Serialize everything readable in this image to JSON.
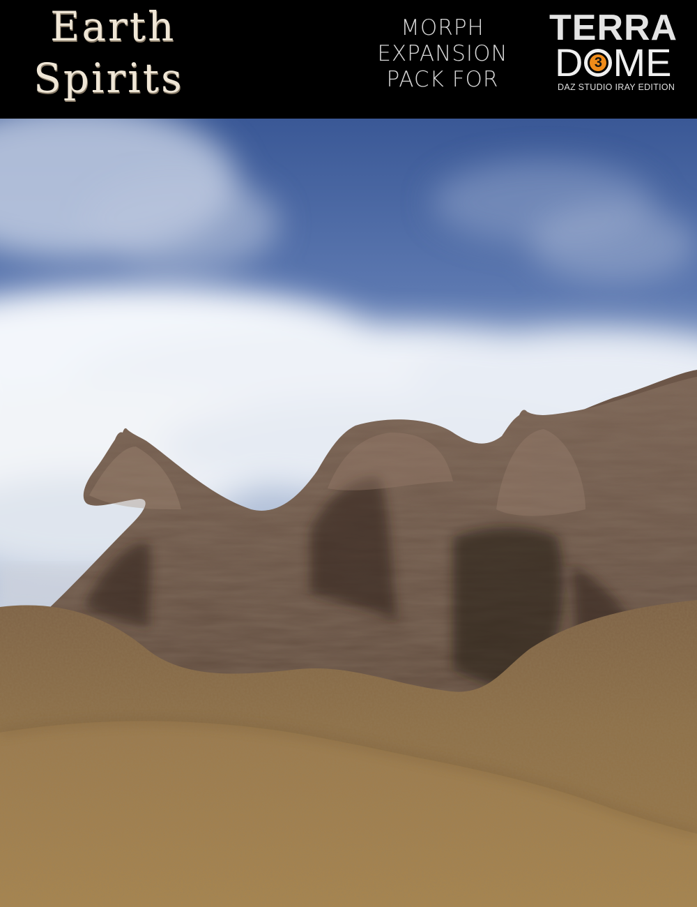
{
  "header": {
    "title_line1": "Earth",
    "title_line2": "Spirits",
    "morph_lines": [
      "MORPH",
      "EXPANSION",
      "PACK FOR"
    ],
    "brand_top": "TERRA",
    "brand_dome_left": "D",
    "brand_dome_number": "3",
    "brand_dome_right": "ME",
    "brand_sub": "DAZ STUDIO IRAY EDITION"
  },
  "colors": {
    "sky_top": "#3b5a9a",
    "cloud": "#f2f5fa",
    "rock": "#6e5a4c",
    "ground": "#8e6f46",
    "accent": "#f08c1a"
  },
  "scene": {
    "subject": "three horse-shaped rock formations in a sandy desert under a cloudy blue sky"
  }
}
